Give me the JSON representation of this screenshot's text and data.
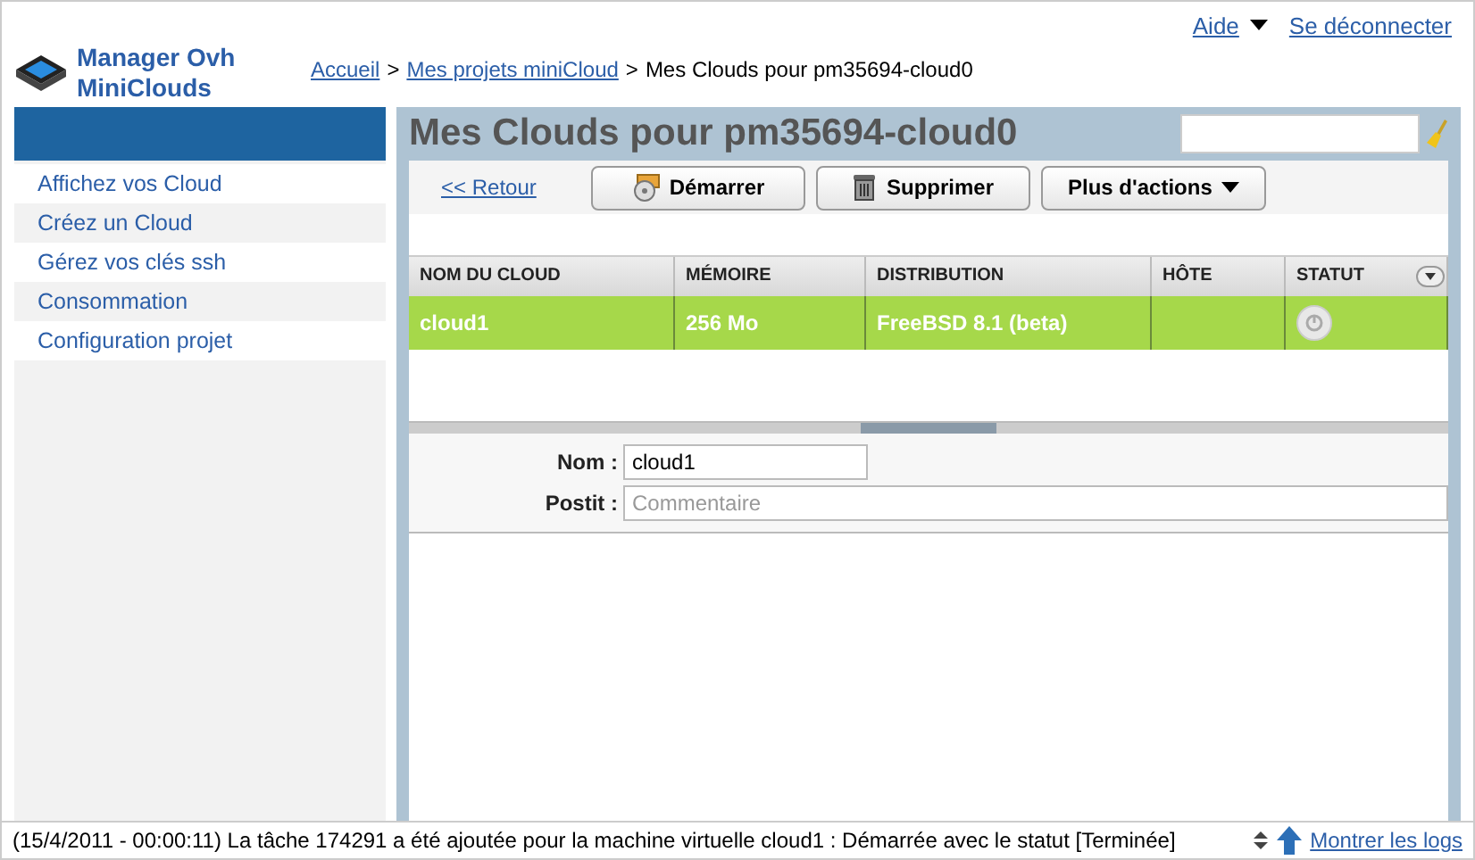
{
  "top_links": [
    {
      "label": "Aide",
      "dropdown": true
    },
    {
      "label": "Se déconnecter",
      "dropdown": false
    }
  ],
  "logo": {
    "line1": "Manager Ovh",
    "line2": "MiniClouds"
  },
  "breadcrumb": {
    "items": [
      {
        "label": "Accueil",
        "kind": "link"
      },
      {
        "label": ">",
        "kind": "separator"
      },
      {
        "label": "Mes projets miniCloud",
        "kind": "link"
      },
      {
        "label": ">",
        "kind": "separator"
      },
      {
        "label": "Mes Clouds pour pm35694-cloud0",
        "kind": "current"
      }
    ]
  },
  "sidebar": {
    "items": [
      {
        "label": "Affichez vos Cloud"
      },
      {
        "label": "Créez un Cloud"
      },
      {
        "label": "Gérez vos clés ssh"
      },
      {
        "label": "Consommation"
      },
      {
        "label": "Configuration projet"
      }
    ]
  },
  "main": {
    "title": "Mes Clouds pour pm35694-cloud0",
    "back_link": "<< Retour",
    "buttons": [
      {
        "label": "Démarrer",
        "kind": "start"
      },
      {
        "label": "Supprimer",
        "kind": "delete"
      },
      {
        "label": "Plus d'actions",
        "kind": "menu"
      }
    ]
  },
  "table": {
    "columns": [
      "NOM DU CLOUD",
      "MÉMOIRE",
      "DISTRIBUTION",
      "HÔTE",
      "STATUT"
    ],
    "rows": [
      {
        "cells": [
          "cloud1",
          "256 Mo",
          "FreeBSD 8.1 (beta)",
          ""
        ],
        "selected": true
      }
    ]
  },
  "form": {
    "name_label": "Nom :",
    "name_value": "cloud1",
    "postit_label": "Postit :",
    "postit_placeholder": "Commentaire"
  },
  "status_bar": {
    "message": "(15/4/2011 - 00:00:11) La tâche 174291 a été ajoutée pour la machine virtuelle cloud1 : Démarrée avec le statut [Terminée]",
    "logs_link": "Montrer les logs"
  }
}
